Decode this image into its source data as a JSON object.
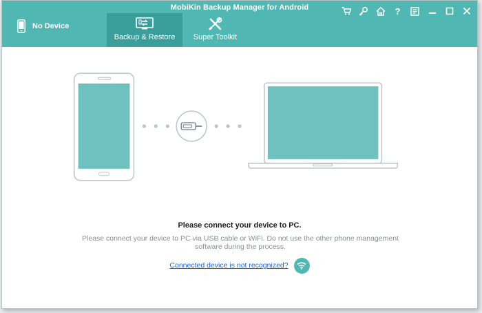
{
  "app": {
    "title": "MobiKin Backup Manager for Android"
  },
  "device": {
    "label": "No Device",
    "icon": "phone-icon"
  },
  "tabs": [
    {
      "label": "Backup & Restore",
      "icon": "backup-restore-icon",
      "active": true
    },
    {
      "label": "Super Toolkit",
      "icon": "toolkit-icon",
      "active": false
    }
  ],
  "window_controls": [
    {
      "name": "cart-icon"
    },
    {
      "name": "key-icon"
    },
    {
      "name": "home-icon"
    },
    {
      "name": "help-icon",
      "glyph": "?"
    },
    {
      "name": "feedback-icon"
    },
    {
      "name": "minimize-icon"
    },
    {
      "name": "maximize-icon"
    },
    {
      "name": "close-icon"
    }
  ],
  "main": {
    "title": "Please connect your device to PC.",
    "description": "Please connect your device to PC via USB cable or WiFi. Do not use the other phone management software during the process.",
    "help_link": "Connected device is not recognized?",
    "wifi_icon": "wifi-icon"
  },
  "colors": {
    "accent": "#50b7b3",
    "accent_dark": "#3a9e9b",
    "screen": "#6fc1c0",
    "outline": "#bcc5c8",
    "link": "#1b61d4"
  }
}
